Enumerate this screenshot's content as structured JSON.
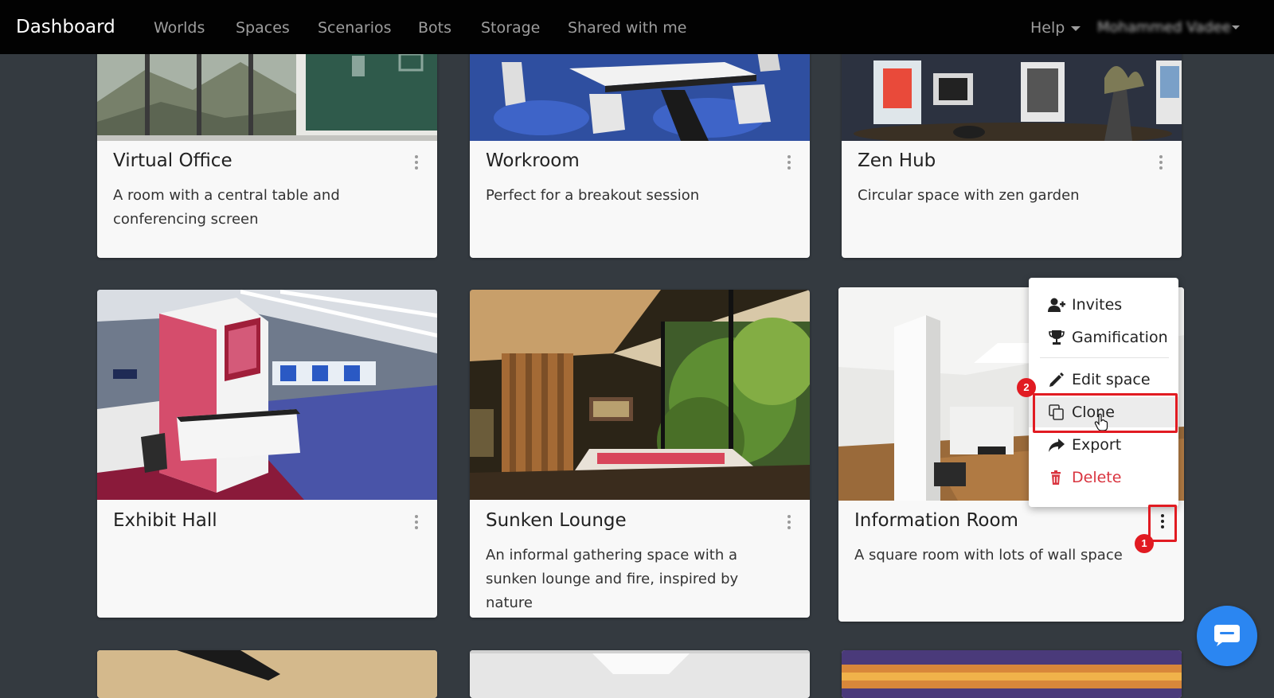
{
  "navbar": {
    "brand": "Dashboard",
    "links": [
      "Worlds",
      "Spaces",
      "Scenarios",
      "Bots",
      "Storage",
      "Shared with me"
    ],
    "help_label": "Help",
    "user_name": "Mohammed Vadee"
  },
  "cards": [
    {
      "title": "Virtual Office",
      "description": "A room with a central table and conferencing screen"
    },
    {
      "title": "Workroom",
      "description": "Perfect for a breakout session"
    },
    {
      "title": "Zen Hub",
      "description": "Circular space with zen garden"
    },
    {
      "title": "Exhibit Hall",
      "description": ""
    },
    {
      "title": "Sunken Lounge",
      "description": "An informal gathering space with a sunken lounge and fire, inspired by nature"
    },
    {
      "title": "Information Room",
      "description": "A square room with lots of wall space"
    }
  ],
  "dropdown": {
    "items": [
      {
        "label": "Invites",
        "icon": "user-plus-icon"
      },
      {
        "label": "Gamification",
        "icon": "trophy-icon"
      },
      {
        "label": "Edit space",
        "icon": "pencil-icon"
      },
      {
        "label": "Clone",
        "icon": "copy-icon"
      },
      {
        "label": "Export",
        "icon": "share-arrow-icon"
      },
      {
        "label": "Delete",
        "icon": "trash-icon"
      }
    ]
  },
  "annotations": {
    "step1": "1",
    "step2": "2"
  },
  "colors": {
    "navbar_bg": "#020202",
    "page_bg": "#343a40",
    "annotation": "#e11b22",
    "danger": "#d9343f",
    "chat_button": "#2b86f1"
  }
}
